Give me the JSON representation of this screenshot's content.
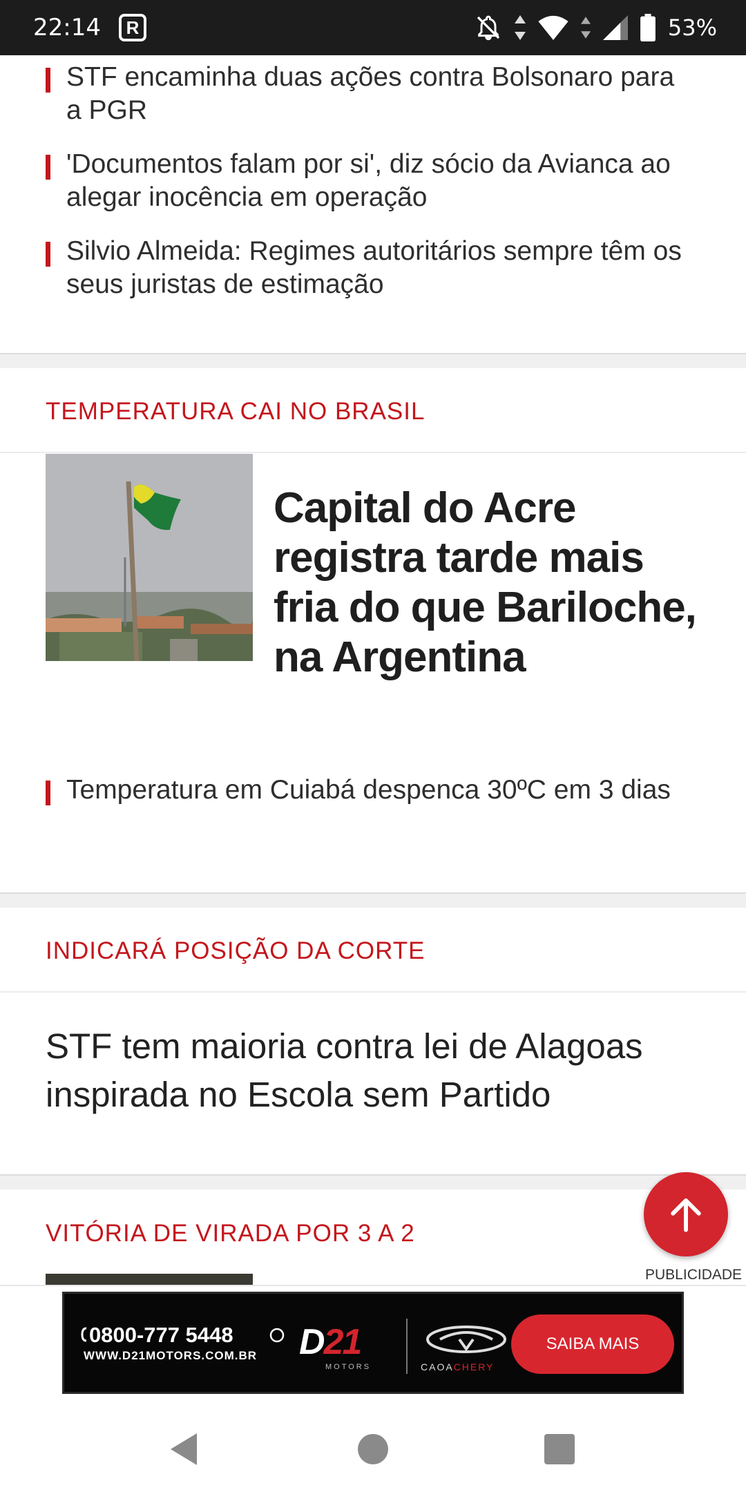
{
  "status_bar": {
    "time": "22:14",
    "app_badge": "R",
    "battery": "53%"
  },
  "top_section": {
    "related": [
      "STF encaminha duas ações contra Bolsonaro para a PGR",
      "'Documentos falam por si', diz sócio da Avianca ao alegar inocência em operação",
      "Silvio Almeida: Regimes autoritários sempre têm os seus juristas de estimação"
    ]
  },
  "section_temp": {
    "kicker": "TEMPERATURA CAI NO BRASIL",
    "headline": "Capital do Acre registra tarde mais fria do que Bariloche, na Argentina",
    "related": "Temperatura em Cuiabá despenca 30ºC em 3 dias"
  },
  "section_court": {
    "kicker": "INDICARÁ POSIÇÃO DA CORTE",
    "headline": "STF tem maioria contra lei de Alagoas inspirada no Escola sem Partido"
  },
  "section_game": {
    "kicker": "VITÓRIA DE VIRADA POR 3 A 2"
  },
  "ad": {
    "label": "PUBLICIDADE",
    "phone": "0800-777 5448",
    "site": "WWW.D21MOTORS.COM.BR",
    "logo_left": "D",
    "logo_right": "21",
    "logo_sub": "MOTORS",
    "brand_left": "CAOA",
    "brand_right": "CHERY",
    "cta": "SAIBA MAIS"
  },
  "colors": {
    "accent": "#c4161c",
    "fab": "#d3252d",
    "status_bar": "#1c1c1c"
  }
}
